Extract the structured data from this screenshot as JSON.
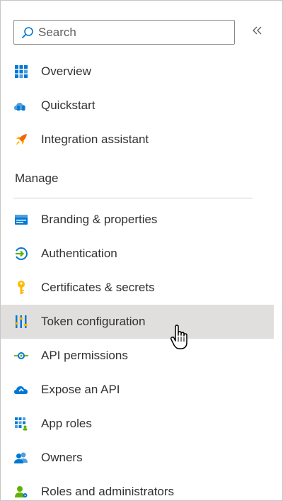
{
  "search": {
    "placeholder": "Search",
    "icon": "search-icon"
  },
  "collapse": {
    "label": "«",
    "icon": "double-chevron-left-icon"
  },
  "top_items": [
    {
      "label": "Overview",
      "icon": "grid-icon"
    },
    {
      "label": "Quickstart",
      "icon": "cloud-people-icon"
    },
    {
      "label": "Integration assistant",
      "icon": "rocket-icon"
    }
  ],
  "manage": {
    "header": "Manage",
    "items": [
      {
        "label": "Branding & properties",
        "icon": "branding-card-icon"
      },
      {
        "label": "Authentication",
        "icon": "authentication-icon"
      },
      {
        "label": "Certificates & secrets",
        "icon": "key-icon"
      },
      {
        "label": "Token configuration",
        "icon": "token-bars-icon",
        "hovered": true
      },
      {
        "label": "API permissions",
        "icon": "api-permissions-icon"
      },
      {
        "label": "Expose an API",
        "icon": "cloud-expose-icon"
      },
      {
        "label": "App roles",
        "icon": "app-roles-grid-icon"
      },
      {
        "label": "Owners",
        "icon": "owners-people-icon"
      },
      {
        "label": "Roles and administrators",
        "icon": "roles-admin-icon"
      }
    ]
  },
  "colors": {
    "accent_blue": "#0078d4",
    "hover_bg": "#e1dfdd",
    "text": "#323130",
    "key_yellow": "#ffb900",
    "rocket_orange": "#f7630c",
    "green": "#5db300"
  }
}
